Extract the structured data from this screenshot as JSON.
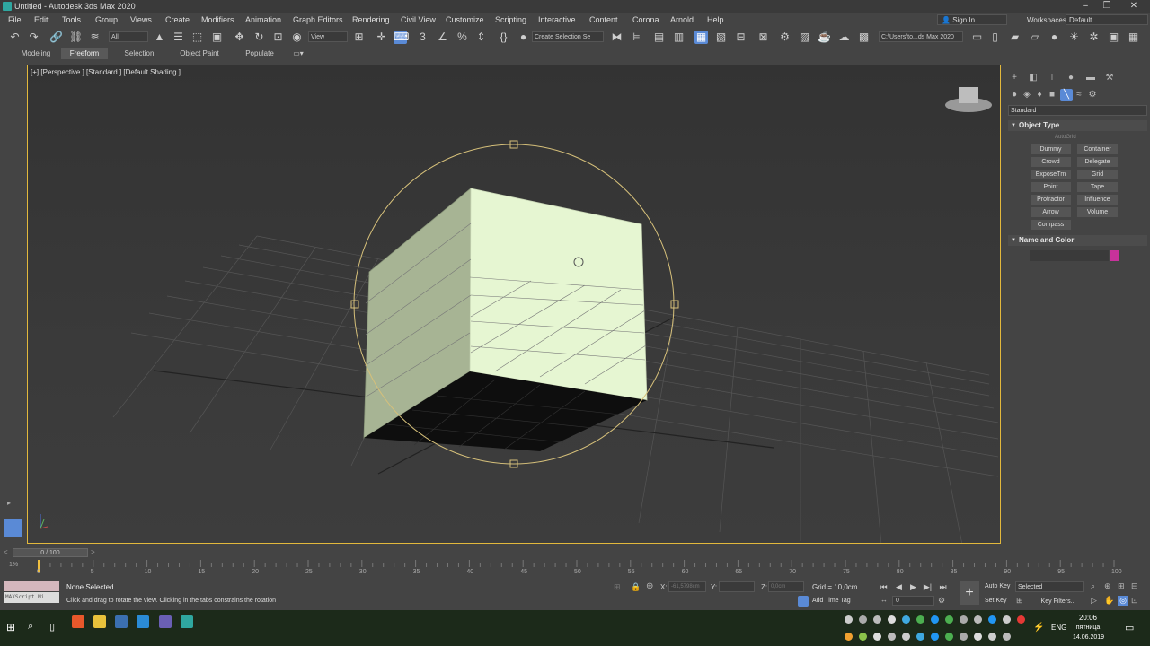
{
  "window": {
    "title": "Untitled - Autodesk 3ds Max 2020"
  },
  "menu": {
    "items": [
      "File",
      "Edit",
      "Tools",
      "Group",
      "Views",
      "Create",
      "Modifiers",
      "Animation",
      "Graph Editors",
      "Rendering",
      "Civil View",
      "Customize",
      "Scripting",
      "Interactive",
      "Content",
      "Corona",
      "Arnold",
      "Help"
    ],
    "sign_in": "Sign In",
    "workspaces_label": "Workspaces:",
    "workspace_value": "Default"
  },
  "toolbar": {
    "selection_filter": "All",
    "ref_coord": "View",
    "named_selection": "Create Selection Se",
    "project_path": "C:\\Users\\to...ds Max 2020"
  },
  "ribbon": {
    "tabs": [
      "Modeling",
      "Freeform",
      "Selection",
      "Object Paint",
      "Populate"
    ],
    "active": "Freeform"
  },
  "viewport": {
    "label": "[+] [Perspective ] [Standard ] [Default Shading ]"
  },
  "command_panel": {
    "category": "Standard",
    "object_type_title": "Object Type",
    "autogrid": "AutoGrid",
    "buttons": [
      "Dummy",
      "Container",
      "Crowd",
      "Delegate",
      "ExposeTm",
      "Grid",
      "Point",
      "Tape",
      "Protractor",
      "Influence",
      "Arrow",
      "Volume",
      "Compass"
    ],
    "name_color_title": "Name and Color",
    "object_color": "#c8329b"
  },
  "timeline": {
    "slider_label": "0 / 100",
    "ticks": [
      "0",
      "5",
      "10",
      "15",
      "20",
      "25",
      "30",
      "35",
      "40",
      "45",
      "50",
      "55",
      "60",
      "65",
      "70",
      "75",
      "80",
      "85",
      "90",
      "95",
      "100"
    ]
  },
  "status": {
    "maxscript": "MAXScript Mi",
    "selection": "None Selected",
    "prompt": "Click and drag to rotate the view.  Clicking in the tabs constrains the rotation",
    "x_label": "X:",
    "x_value": "-61,5798cm",
    "y_label": "Y:",
    "z_label": "Z:",
    "z_value": "0,0cm",
    "grid": "Grid = 10,0cm",
    "add_time_tag": "Add Time Tag",
    "frame": "0",
    "auto_key": "Auto Key",
    "set_key": "Set Key",
    "key_set": "Selected",
    "key_filters": "Key Filters..."
  },
  "taskbar": {
    "language": "ENG",
    "time": "20:06",
    "day": "пятница",
    "date": "14.06.2019"
  }
}
